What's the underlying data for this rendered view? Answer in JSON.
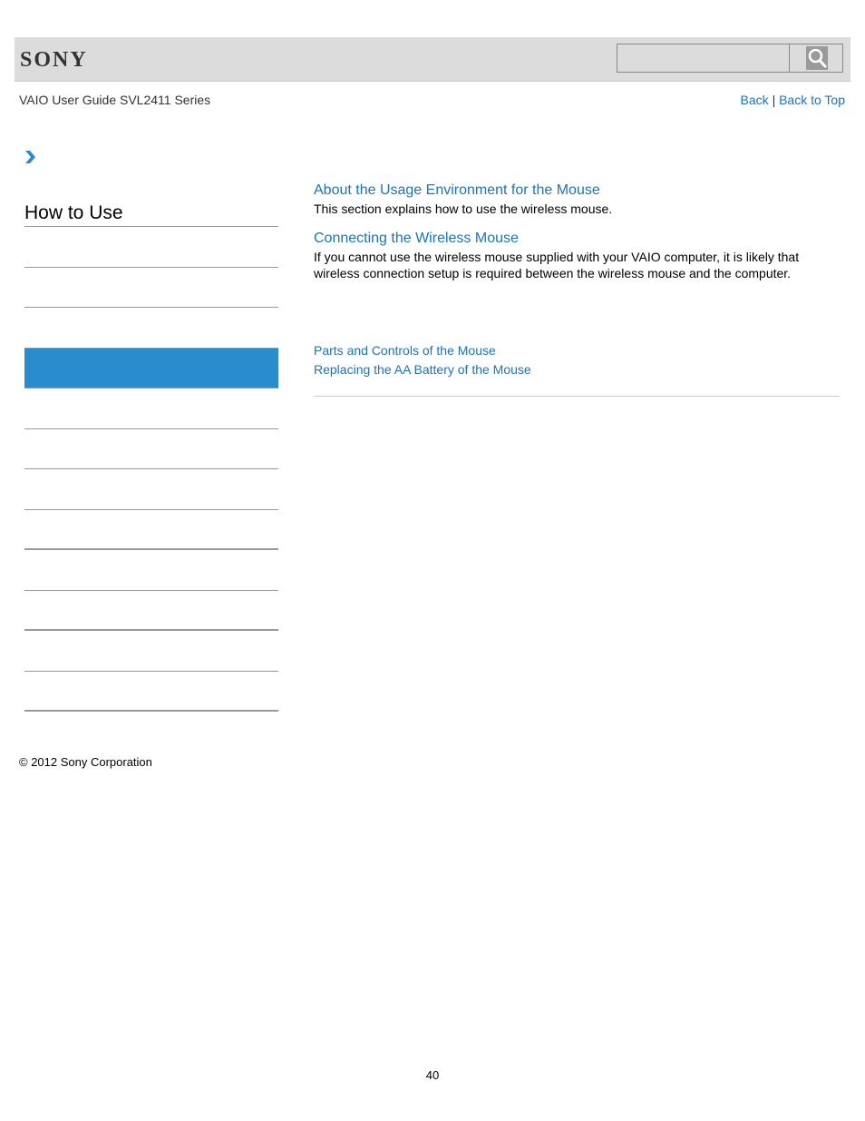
{
  "header": {
    "brand": "SONY",
    "search": {
      "value": "",
      "placeholder": ""
    },
    "search_icon": "search-icon"
  },
  "guide_title": "VAIO User Guide SVL2411 Series",
  "topnav": {
    "back": "Back",
    "separator": "|",
    "back_to_top": "Back to Top"
  },
  "breadcrumb_icon": "chevron-right-icon",
  "sidebar": {
    "title": "How to Use",
    "items": [
      {
        "label": "",
        "active": false
      },
      {
        "label": "",
        "active": false
      },
      {
        "label": "",
        "active": false
      },
      {
        "label": "",
        "active": true
      },
      {
        "label": "",
        "active": false
      },
      {
        "label": "",
        "active": false
      },
      {
        "label": "",
        "active": false
      },
      {
        "label": "",
        "active": false
      },
      {
        "label": "",
        "active": false
      },
      {
        "label": "",
        "active": false
      },
      {
        "label": "",
        "active": false
      },
      {
        "label": "",
        "active": false
      }
    ],
    "active_color": "#2a8ccc"
  },
  "main": {
    "topics": [
      {
        "title": "About the Usage Environment for the Mouse",
        "description": "This section explains how to use the wireless mouse."
      },
      {
        "title": "Connecting the Wireless Mouse",
        "description": "If you cannot use the wireless mouse supplied with your VAIO computer, it is likely that wireless connection setup is required between the wireless mouse and the computer."
      }
    ],
    "related_links": [
      "Parts and Controls of the Mouse",
      "Replacing the AA Battery of the Mouse"
    ]
  },
  "footer": {
    "copyright": "© 2012 Sony Corporation",
    "page_number": "40"
  },
  "colors": {
    "link": "#1a73c8",
    "header_bg": "#dcdcdc"
  }
}
